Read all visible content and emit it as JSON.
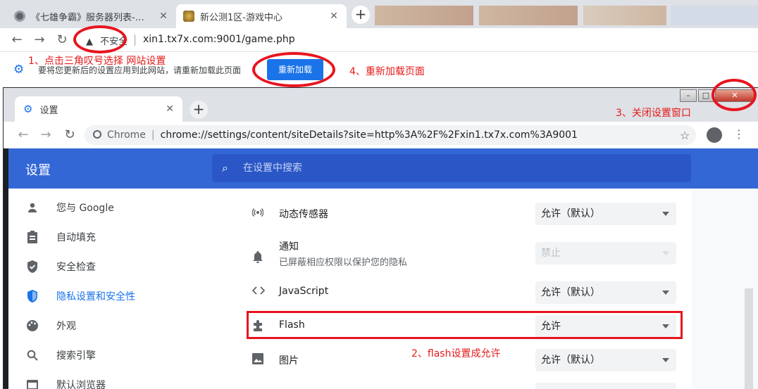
{
  "outer": {
    "tabs": [
      {
        "title": "《七雄争霸》服务器列表-【天下"
      },
      {
        "title": "新公测1区-游戏中心"
      }
    ],
    "omnibox": {
      "security": "不安全",
      "url": "xin1.tx7x.com:9001/game.php"
    },
    "infobar": {
      "message": "要将您更新后的设置应用到此网站，请重新加载此页面",
      "button": "重新加载"
    }
  },
  "annotations": {
    "step1": "1、点击三角叹号选择 网站设置",
    "step2": "2、flash设置成允许",
    "step3": "3、关闭设置窗口",
    "step4": "4、重新加载页面"
  },
  "inner": {
    "tab_title": "设置",
    "url_prefix": "Chrome",
    "url": "chrome://settings/content/siteDetails?site=http%3A%2F%2Fxin1.tx7x.com%3A9001",
    "header_title": "设置",
    "search_placeholder": "在设置中搜索",
    "sidebar": [
      {
        "label": "您与 Google",
        "icon": "person-icon"
      },
      {
        "label": "自动填充",
        "icon": "clipboard-icon"
      },
      {
        "label": "安全检查",
        "icon": "shield-check-icon"
      },
      {
        "label": "隐私设置和安全性",
        "icon": "shield-icon"
      },
      {
        "label": "外观",
        "icon": "palette-icon"
      },
      {
        "label": "搜索引擎",
        "icon": "search-icon"
      },
      {
        "label": "默认浏览器",
        "icon": "browser-icon"
      }
    ],
    "rows": [
      {
        "label": "动态传感器",
        "value": "允许（默认）",
        "icon": "sensor-icon"
      },
      {
        "label": "通知",
        "sub": "已屏蔽相应权限以保护您的隐私",
        "value": "禁止",
        "icon": "bell-icon"
      },
      {
        "label": "JavaScript",
        "value": "允许（默认）",
        "icon": "code-icon"
      },
      {
        "label": "Flash",
        "value": "允许",
        "icon": "puzzle-icon"
      },
      {
        "label": "图片",
        "value": "允许（默认）",
        "icon": "image-icon"
      }
    ]
  },
  "colors": {
    "accent": "#1a73e8",
    "header": "#3367d6",
    "annotation": "#e61a1a"
  }
}
